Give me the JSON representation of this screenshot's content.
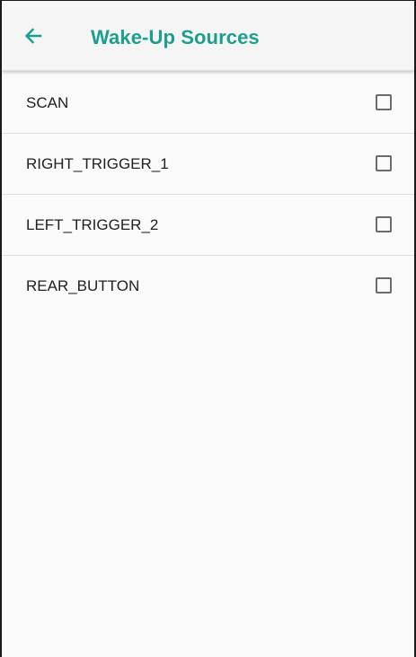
{
  "colors": {
    "accent": "#1e9e8c",
    "text": "#212121",
    "background": "#fafafa"
  },
  "toolbar": {
    "back_icon": "arrow-left-icon",
    "title": "Wake-Up Sources"
  },
  "sources": [
    {
      "label": "SCAN",
      "checked": false
    },
    {
      "label": "RIGHT_TRIGGER_1",
      "checked": false
    },
    {
      "label": "LEFT_TRIGGER_2",
      "checked": false
    },
    {
      "label": "REAR_BUTTON",
      "checked": false
    }
  ]
}
